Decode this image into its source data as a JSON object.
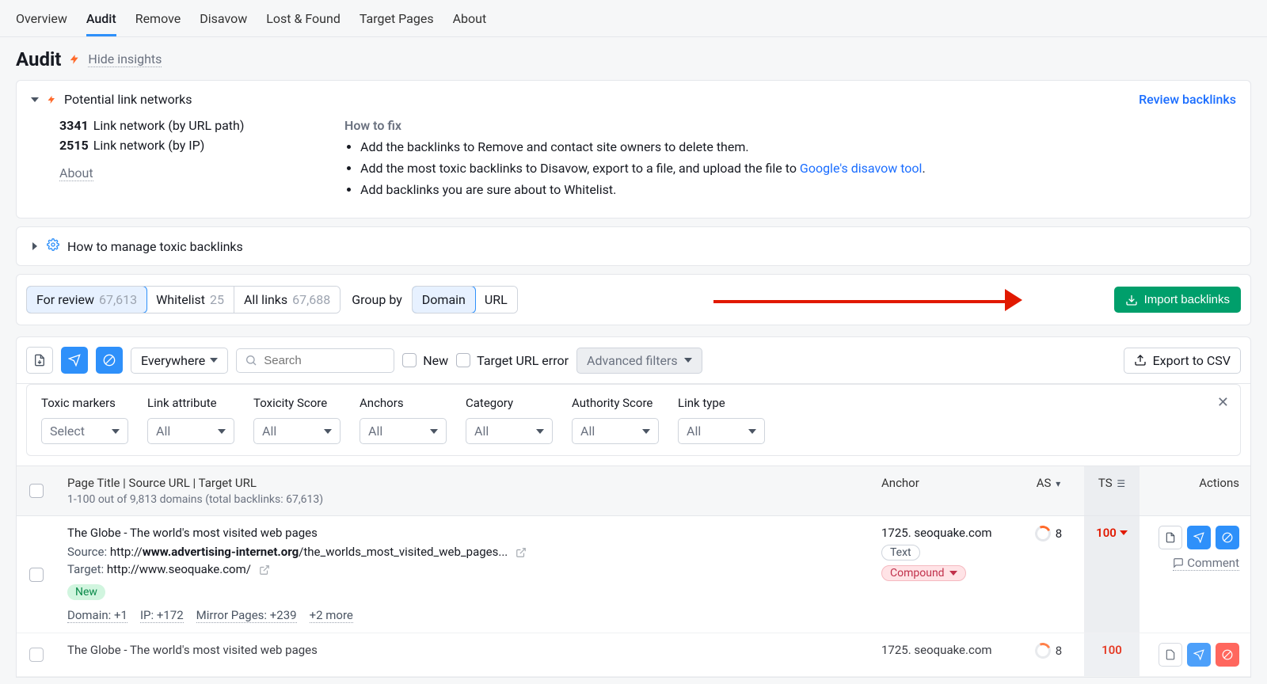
{
  "nav": {
    "tabs": [
      "Overview",
      "Audit",
      "Remove",
      "Disavow",
      "Lost & Found",
      "Target Pages",
      "About"
    ],
    "active": "Audit"
  },
  "page": {
    "title": "Audit",
    "hide_insights": "Hide insights"
  },
  "insight_card": {
    "title": "Potential link networks",
    "review": "Review backlinks",
    "rows": [
      {
        "count": "3341",
        "label": "Link network (by URL path)"
      },
      {
        "count": "2515",
        "label": "Link network (by IP)"
      }
    ],
    "about": "About",
    "howfix_title": "How to fix",
    "howfix": [
      "Add the backlinks to Remove and contact site owners to delete them.",
      "Add the most toxic backlinks to Disavow, export to a file, and upload the file to ",
      "Add backlinks you are sure about to Whitelist."
    ],
    "disavow_link": "Google's disavow tool"
  },
  "manage_card": {
    "title": "How to manage toxic backlinks"
  },
  "toolbar": {
    "tabs": [
      {
        "label": "For review",
        "count": "67,613",
        "active": true
      },
      {
        "label": "Whitelist",
        "count": "25"
      },
      {
        "label": "All links",
        "count": "67,688"
      }
    ],
    "groupby_label": "Group by",
    "groupby": [
      {
        "label": "Domain",
        "active": true
      },
      {
        "label": "URL"
      }
    ],
    "import": "Import backlinks"
  },
  "subbar": {
    "everywhere": "Everywhere",
    "search_placeholder": "Search",
    "new_label": "New",
    "target_err": "Target URL error",
    "advanced": "Advanced filters",
    "export": "Export to CSV"
  },
  "filters": [
    {
      "label": "Toxic markers",
      "value": "Select"
    },
    {
      "label": "Link attribute",
      "value": "All"
    },
    {
      "label": "Toxicity Score",
      "value": "All"
    },
    {
      "label": "Anchors",
      "value": "All"
    },
    {
      "label": "Category",
      "value": "All"
    },
    {
      "label": "Authority Score",
      "value": "All"
    },
    {
      "label": "Link type",
      "value": "All"
    }
  ],
  "table": {
    "header_main": "Page Title | Source URL | Target URL",
    "header_sub": "1-100 out of 9,813 domains (total backlinks: 67,613)",
    "header_anchor": "Anchor",
    "header_as": "AS",
    "header_ts": "TS",
    "header_actions": "Actions",
    "row": {
      "title": "The Globe - The world's most visited web pages",
      "src_label": "Source:",
      "src_pre": " http://",
      "src_bold": "www.advertising-internet.org",
      "src_rest": "/the_worlds_most_visited_web_pages...",
      "tgt_label": "Target:",
      "tgt_url": " http://www.seoquake.com/",
      "new": "New",
      "meta": [
        "Domain: +1",
        "IP: +172",
        "Mirror Pages: +239",
        "+2 more"
      ],
      "anchor": "1725. seoquake.com",
      "anchor_pill": "Text",
      "compound": "Compound",
      "as": "8",
      "ts": "100",
      "comment": "Comment"
    },
    "row2_title": "The Globe - The world's most visited web pages",
    "row2_anchor": "1725. seoquake.com",
    "row2_as": "8",
    "row2_ts": "100"
  }
}
